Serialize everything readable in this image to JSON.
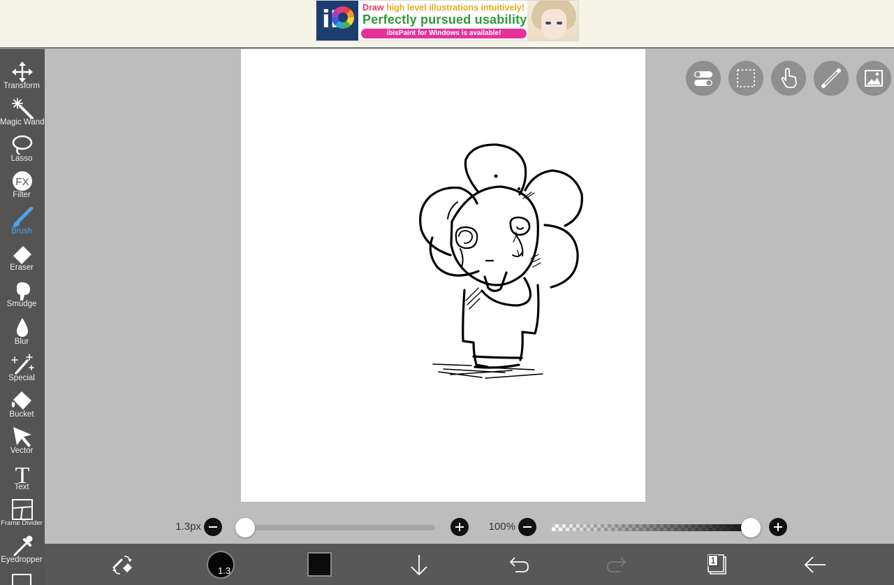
{
  "ad": {
    "logo_text": "iP",
    "line1_word": "Draw",
    "line1_rest": "high level illustrations intuitively!",
    "line2": "Perfectly pursued usability!",
    "line3": "ibisPaint for Windows is available!"
  },
  "tools": [
    {
      "label": "Transform",
      "icon": "move-arrows-icon"
    },
    {
      "label": "Magic Wand",
      "icon": "magic-wand-icon"
    },
    {
      "label": "Lasso",
      "icon": "lasso-icon"
    },
    {
      "label": "Filter",
      "icon": "fx-icon"
    },
    {
      "label": "Brush",
      "icon": "brush-icon",
      "selected": true
    },
    {
      "label": "Eraser",
      "icon": "eraser-icon"
    },
    {
      "label": "Smudge",
      "icon": "smudge-icon"
    },
    {
      "label": "Blur",
      "icon": "droplet-icon"
    },
    {
      "label": "Special",
      "icon": "sparkle-wand-icon"
    },
    {
      "label": "Bucket",
      "icon": "bucket-icon"
    },
    {
      "label": "Vector",
      "icon": "arrow-cursor-icon"
    },
    {
      "label": "Text",
      "icon": "text-t-icon"
    },
    {
      "label": "Frame Divider",
      "icon": "frame-divider-icon"
    },
    {
      "label": "Eyedropper",
      "icon": "eyedropper-icon"
    }
  ],
  "filter_icon_text": "FX",
  "text_icon_text": "T",
  "top_buttons": [
    {
      "icon": "toggle-icon"
    },
    {
      "icon": "selection-icon"
    },
    {
      "icon": "hand-icon"
    },
    {
      "icon": "ruler-icon"
    },
    {
      "icon": "image-icon"
    }
  ],
  "brush_size": {
    "label": "1.3px",
    "value": 1.3
  },
  "opacity": {
    "label": "100%",
    "value": 100
  },
  "bottom": {
    "brush_preview_label": "1.3",
    "current_color": "#0b0b0b",
    "layer_count": "1"
  },
  "colors": {
    "toolbar": "#545454",
    "accent": "#4aa5ee",
    "workspace": "#bdbdbd",
    "bottombar": "#585858"
  }
}
